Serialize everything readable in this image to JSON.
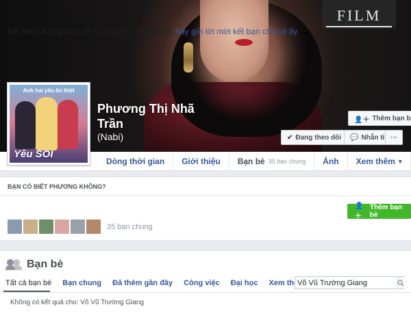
{
  "cover": {
    "watermark": "FILM"
  },
  "profile": {
    "name": "Phương Thị Nhã Trần",
    "nickname": "(Nabi)",
    "picture": {
      "headline": "Anh hai yêu ôn thời",
      "logo_text": "Yêu SOI"
    }
  },
  "actions": {
    "add_friend": "Thêm bạn bè",
    "following": "Đang theo dõi",
    "message": "Nhắn tin",
    "more": "···"
  },
  "nav": {
    "timeline": "Dòng thời gian",
    "about": "Giới thiệu",
    "friends": "Bạn bè",
    "friends_count": "35 bạn chung",
    "photos": "Ảnh",
    "more": "Xem thêm"
  },
  "suggestion": {
    "heading": "BẠN CÓ BIẾT PHƯƠNG KHÔNG?",
    "text_prefix": "Để xem những điều cô ấy chia sẻ với bạn bè,",
    "text_link": "hãy gửi lời mời kết bạn cho cô ấy.",
    "button": "Thêm bạn bè",
    "mutual_label": "35 bạn chung",
    "avatar_colors": [
      "#8a9bb0",
      "#c9b08a",
      "#6f8f6a",
      "#d9a6a6",
      "#9aa0a8",
      "#b08968"
    ]
  },
  "friends": {
    "title": "Bạn bè",
    "tabs": [
      "Tất cả bạn bè",
      "Bạn chung",
      "Đã thêm gần đây",
      "Công việc",
      "Đại học",
      "Xem thêm"
    ],
    "search_value": "Võ Vũ Trường Giang",
    "no_results": "Không có kết quả cho: Võ Vũ Trường Giang"
  },
  "colors": {
    "link": "#365899",
    "green": "#42b72a",
    "lips": "#b81d2a"
  }
}
